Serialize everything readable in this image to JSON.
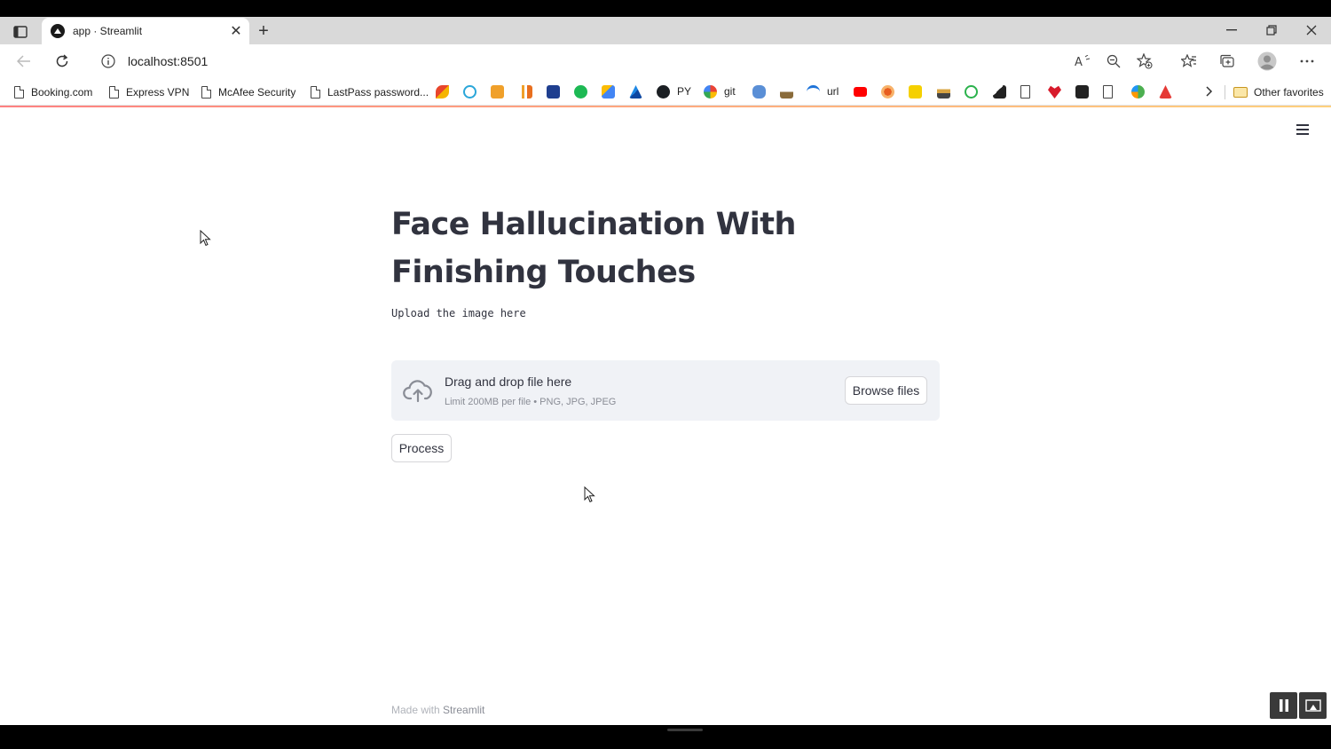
{
  "browser": {
    "tab_title": "app · Streamlit",
    "new_tab_symbol": "+",
    "address": "localhost:8501",
    "bookmarks": [
      {
        "label": "Booking.com",
        "icon": "page-icon"
      },
      {
        "label": "Express VPN",
        "icon": "page-icon"
      },
      {
        "label": "McAfee Security",
        "icon": "page-icon"
      },
      {
        "label": "LastPass password...",
        "icon": "page-icon"
      }
    ],
    "bookmark_text_labels": {
      "py": "PY",
      "git": "git",
      "url": "url"
    },
    "other_favorites": "Other favorites"
  },
  "app": {
    "title": "Face Hallucination With Finishing Touches",
    "subtitle": "Upload the image here",
    "uploader": {
      "drop_title": "Drag and drop file here",
      "limit": "Limit 200MB per file • PNG, JPG, JPEG",
      "browse_label": "Browse files"
    },
    "process_label": "Process",
    "footer": {
      "prefix": "Made with ",
      "brand": "Streamlit"
    }
  },
  "colors": {
    "accent": "#ff4b4b",
    "text": "#31333f",
    "uploader_bg": "#f0f2f6"
  }
}
